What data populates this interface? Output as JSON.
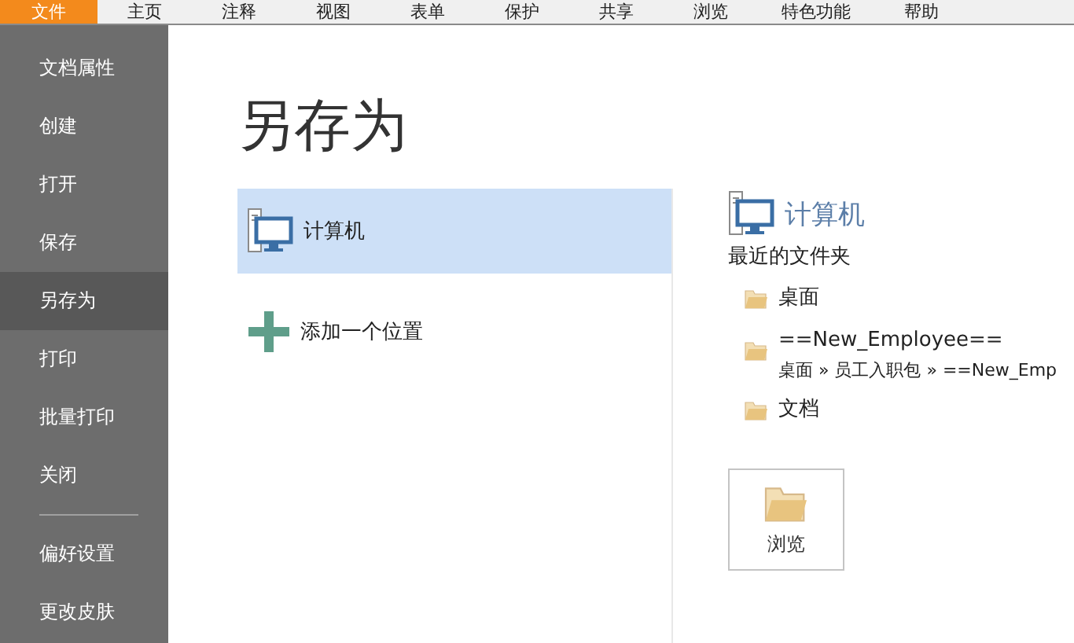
{
  "menu": [
    {
      "label": "文件",
      "selected": true
    },
    {
      "label": "主页",
      "selected": false
    },
    {
      "label": "注释",
      "selected": false
    },
    {
      "label": "视图",
      "selected": false
    },
    {
      "label": "表单",
      "selected": false
    },
    {
      "label": "保护",
      "selected": false
    },
    {
      "label": "共享",
      "selected": false
    },
    {
      "label": "浏览",
      "selected": false
    },
    {
      "label": "特色功能",
      "selected": false
    },
    {
      "label": "帮助",
      "selected": false
    }
  ],
  "sidebar": {
    "items": [
      {
        "label": "文档属性",
        "selected": false
      },
      {
        "label": "创建",
        "selected": false
      },
      {
        "label": "打开",
        "selected": false
      },
      {
        "label": "保存",
        "selected": false
      },
      {
        "label": "另存为",
        "selected": true
      },
      {
        "label": "打印",
        "selected": false
      },
      {
        "label": "批量打印",
        "selected": false
      },
      {
        "label": "关闭",
        "selected": false
      }
    ],
    "bottom_items": [
      {
        "label": "偏好设置",
        "selected": false
      },
      {
        "label": "更改皮肤",
        "selected": false
      }
    ]
  },
  "title": "另存为",
  "locations": [
    {
      "kind": "computer",
      "label": "计算机",
      "selected": true
    },
    {
      "kind": "add",
      "label": "添加一个位置",
      "selected": false
    }
  ],
  "detail": {
    "heading": "计算机",
    "recent_label": "最近的文件夹",
    "folders": [
      {
        "name": "桌面"
      },
      {
        "name": "==New_Employee==",
        "path": "桌面 » 员工入职包 » ==New_Emp"
      },
      {
        "name": "文档"
      }
    ],
    "browse_button": "浏览"
  }
}
